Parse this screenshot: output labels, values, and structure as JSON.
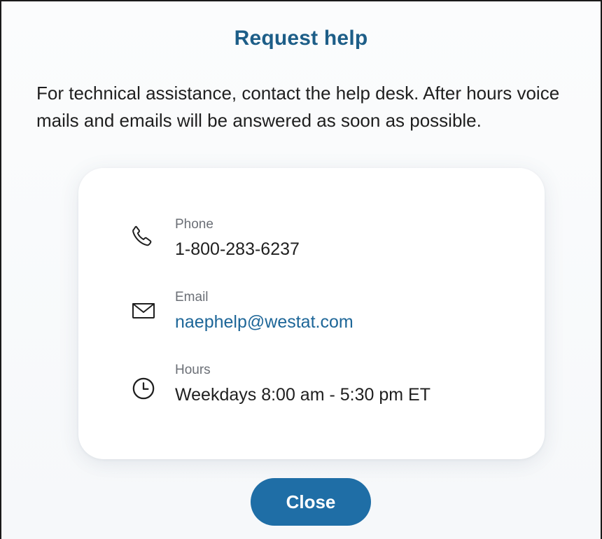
{
  "dialog": {
    "title": "Request help",
    "intro": "For technical assistance, contact the help desk. After hours voice mails and emails will be answered as soon as possible.",
    "close_label": "Close",
    "accent_color": "#1d5e88",
    "button_color": "#1f6ea6"
  },
  "contact": {
    "phone": {
      "icon": "phone-icon",
      "label": "Phone",
      "value": "1-800-283-6237"
    },
    "email": {
      "icon": "envelope-icon",
      "label": "Email",
      "value": "naephelp@westat.com"
    },
    "hours": {
      "icon": "clock-icon",
      "label": "Hours",
      "value": "Weekdays 8:00 am - 5:30 pm ET"
    }
  }
}
